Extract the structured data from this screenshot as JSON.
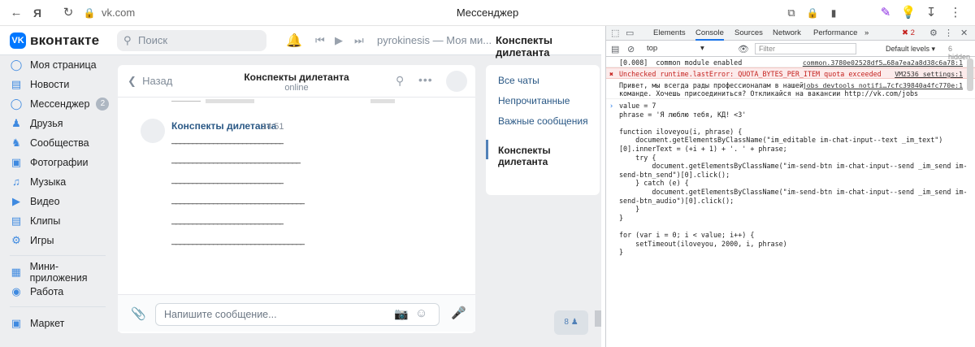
{
  "browser": {
    "title": "Мессенджер",
    "url": "vk.com",
    "logo": "Я"
  },
  "vk": {
    "logo_text": "вконтакте",
    "logo_mark": "VK",
    "search_placeholder": "Поиск",
    "now_playing": "pyrokinesis — Моя ми...",
    "header_chat": "Конспекты дилетанта",
    "menu": [
      {
        "label": "Моя страница",
        "icon": "user-circle-icon"
      },
      {
        "label": "Новости",
        "icon": "news-icon"
      },
      {
        "label": "Мессенджер",
        "icon": "message-icon",
        "badge": "2"
      },
      {
        "label": "Друзья",
        "icon": "friends-icon"
      },
      {
        "label": "Сообщества",
        "icon": "communities-icon"
      },
      {
        "label": "Фотографии",
        "icon": "photo-icon"
      },
      {
        "label": "Музыка",
        "icon": "music-icon"
      },
      {
        "label": "Видео",
        "icon": "video-icon"
      },
      {
        "label": "Клипы",
        "icon": "clips-icon"
      },
      {
        "label": "Игры",
        "icon": "games-icon"
      },
      {
        "label": "Мини-приложения",
        "icon": "apps-icon"
      },
      {
        "label": "Работа",
        "icon": "work-icon"
      },
      {
        "label": "Маркет",
        "icon": "market-icon"
      }
    ],
    "chat": {
      "back_label": "Назад",
      "name": "Конспекты дилетанта",
      "status": "online",
      "message": {
        "author": "Конспекты дилетанта",
        "time": "14:51",
        "lines": [
          "___________________________",
          "_______________________________",
          "___________________________",
          "________________________________",
          "___________________________",
          "________________________________"
        ]
      },
      "input_placeholder": "Напишите сообщение..."
    },
    "folders": [
      {
        "label": "Все чаты"
      },
      {
        "label": "Непрочитанные"
      },
      {
        "label": "Важные сообщения"
      },
      {
        "label": "Конспекты дилетанта"
      }
    ],
    "group_count": "8"
  },
  "devtools": {
    "tabs": [
      "Elements",
      "Console",
      "Sources",
      "Network",
      "Performance"
    ],
    "more_tabs": "»",
    "error_count": "2",
    "context": "top",
    "filter_placeholder": "Filter",
    "levels": "Default levels",
    "hidden": "6 hidden",
    "log1": {
      "text": "[0.008]  common module enabled",
      "source": "common.3780e02528df5…68a7ea2a8d38c6a78:1"
    },
    "log2": {
      "text": "Unchecked runtime.lastError: QUOTA_BYTES_PER_ITEM quota exceeded",
      "source": "VM2536 settings:1"
    },
    "log3": {
      "line1": "Привет, мы всегда рады профессионалам в нашей",
      "line2": "команде. Хочешь присоединиться? Откликайся на вакансии http://vk.com/jobs",
      "source": "jobs devtools notifi…7cfc39840a4fc770e:1"
    },
    "code": [
      "value = 7",
      "phrase = 'Я люблю тебя, КД! <3'",
      "",
      "function iloveyou(i, phrase) {",
      "    document.getElementsByClassName(\"im_editable im-chat-input--text _im_text\")",
      "[0].innerText = (+i + 1) + '. ' + phrase;",
      "    try {",
      "        document.getElementsByClassName(\"im-send-btn im-chat-input--send _im_send im-",
      "send-btn_send\")[0].click();",
      "    } catch (e) {",
      "        document.getElementsByClassName(\"im-send-btn im-chat-input--send _im_send im-",
      "send-btn_audio\")[0].click();",
      "    }",
      "}",
      "",
      "for (var i = 0; i < value; i++) {",
      "    setTimeout(iloveyou, 2000, i, phrase)",
      "}"
    ]
  }
}
